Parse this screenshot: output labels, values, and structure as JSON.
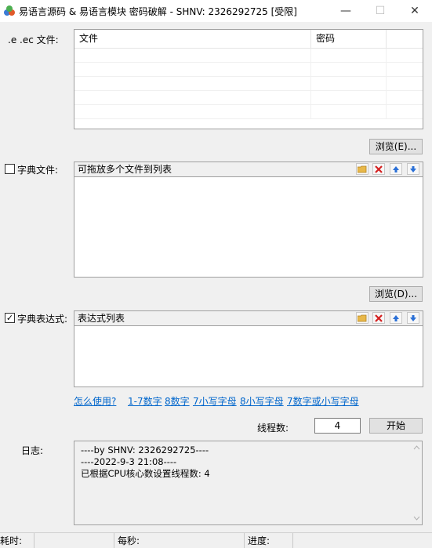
{
  "window": {
    "title": "易语言源码 & 易语言模块 密码破解 - SHNV: 2326292725 [受限]",
    "min_glyph": "—",
    "max_glyph": "☐",
    "close_glyph": "✕"
  },
  "file_section": {
    "label": ".e .ec 文件:",
    "columns": [
      "文件",
      "密码"
    ],
    "browse_label": "浏览(E)..."
  },
  "dict_section": {
    "label": "字典文件:",
    "checked": false,
    "header": "可拖放多个文件到列表",
    "browse_label": "浏览(D)..."
  },
  "expr_section": {
    "label": "字典表达式:",
    "checked": true,
    "header": "表达式列表"
  },
  "links": [
    "怎么使用?",
    "1-7数字",
    "8数字",
    "7小写字母",
    "8小写字母",
    "7数字或小写字母"
  ],
  "threads": {
    "label": "线程数:",
    "value": "4",
    "start_label": "开始"
  },
  "log": {
    "label": "日志:",
    "lines": [
      "----by SHNV: 2326292725----",
      "----2022-9-3 21:08----",
      "已根据CPU核心数设置线程数: 4"
    ]
  },
  "status": {
    "elapsed": "耗时:",
    "per_second": "每秒:",
    "progress": "进度:"
  },
  "icons": {
    "toolbar": [
      "folder-icon",
      "delete-icon",
      "move-up-icon",
      "move-down-icon"
    ]
  },
  "colors": {
    "link": "#0066cc",
    "delete_red": "#d42020",
    "arrow_blue": "#2a6fd6",
    "folder_yellow": "#e8b84a"
  }
}
